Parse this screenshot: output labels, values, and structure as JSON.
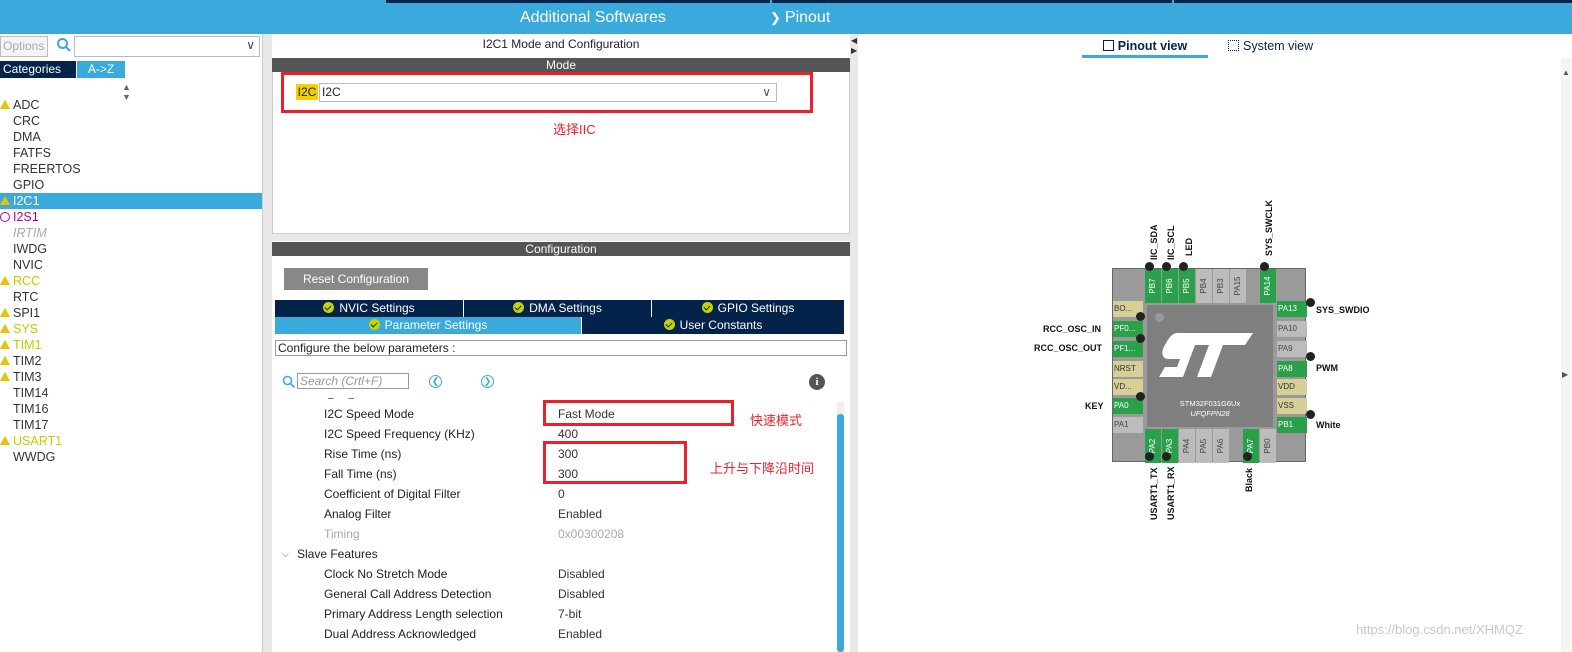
{
  "topbar": {
    "tab1": "Additional Softwares",
    "tab2": "Pinout",
    "tab2_icon": "chevron-down-icon"
  },
  "left": {
    "options_label": "Options",
    "tab_categories": "Categories",
    "tab_az": "A->Z",
    "items": [
      "ADC",
      "CRC",
      "DMA",
      "FATFS",
      "FREERTOS",
      "GPIO",
      "I2C1",
      "I2S1",
      "IRTIM",
      "IWDG",
      "NVIC",
      "RCC",
      "RTC",
      "SPI1",
      "SYS",
      "TIM1",
      "TIM2",
      "TIM3",
      "TIM14",
      "TIM16",
      "TIM17",
      "USART1",
      "WWDG"
    ]
  },
  "middle": {
    "title": "I2C1 Mode and Configuration",
    "mode_header": "Mode",
    "i2c_label": "I2C",
    "i2c_value": "I2C",
    "annotation_select": "选择IIC",
    "config_header": "Configuration",
    "reset_button": "Reset Configuration",
    "tabs_row1": [
      "NVIC Settings",
      "DMA Settings",
      "GPIO Settings"
    ],
    "tabs_row2": [
      "Parameter Settings",
      "User Constants"
    ],
    "configure_text": "Configure the below parameters :",
    "search_placeholder": "Search (Crtl+F)",
    "params": [
      {
        "key": "I2C Speed Mode",
        "value": "Fast Mode"
      },
      {
        "key": "I2C Speed Frequency (KHz)",
        "value": "400"
      },
      {
        "key": "Rise Time (ns)",
        "value": "300"
      },
      {
        "key": "Fall Time (ns)",
        "value": "300"
      },
      {
        "key": "Coefficient of Digital Filter",
        "value": "0"
      },
      {
        "key": "Analog Filter",
        "value": "Enabled"
      },
      {
        "key": "Timing",
        "value": "0x00300208"
      }
    ],
    "group_slave": "Slave Features",
    "slave_params": [
      {
        "key": "Clock No Stretch Mode",
        "value": "Disabled"
      },
      {
        "key": "General Call Address Detection",
        "value": "Disabled"
      },
      {
        "key": "Primary Address Length selection",
        "value": "7-bit"
      },
      {
        "key": "Dual Address Acknowledged",
        "value": "Enabled"
      }
    ],
    "annotation_fast": "快速模式",
    "annotation_time": "上升与下降沿时间"
  },
  "right": {
    "tab_pinout": "Pinout view",
    "tab_system": "System view",
    "chip_name": "STM32F031G6Ux",
    "chip_package": "UFQFPN28",
    "top_pins": [
      "PB7",
      "PB6",
      "PB5",
      "PB4",
      "PB3",
      "PA15",
      "PA14"
    ],
    "bottom_pins": [
      "PA2",
      "PA3",
      "PA4",
      "PA5",
      "PA6",
      "PA7",
      "PB0"
    ],
    "left_pins": [
      "BO...",
      "PF0...",
      "PF1...",
      "NRST",
      "VD...",
      "PA0",
      "PA1"
    ],
    "right_pins": [
      "PA13",
      "PA10",
      "PA9",
      "PA8",
      "VDD",
      "VSS",
      "PB1"
    ],
    "labels": {
      "pb7": "IIC_SDA",
      "pb6": "IIC_SCL",
      "pb5": "LED",
      "pa14": "SYS_SWCLK",
      "pa13": "SYS_SWDIO",
      "pf0": "RCC_OSC_IN",
      "pf1": "RCC_OSC_OUT",
      "pa0": "KEY",
      "pa8": "PWM",
      "pb1": "White",
      "pa2": "USART1_TX",
      "pa3": "USART1_RX",
      "pa7": "Black"
    }
  },
  "watermark": "https://blog.csdn.net/XHMQZ"
}
